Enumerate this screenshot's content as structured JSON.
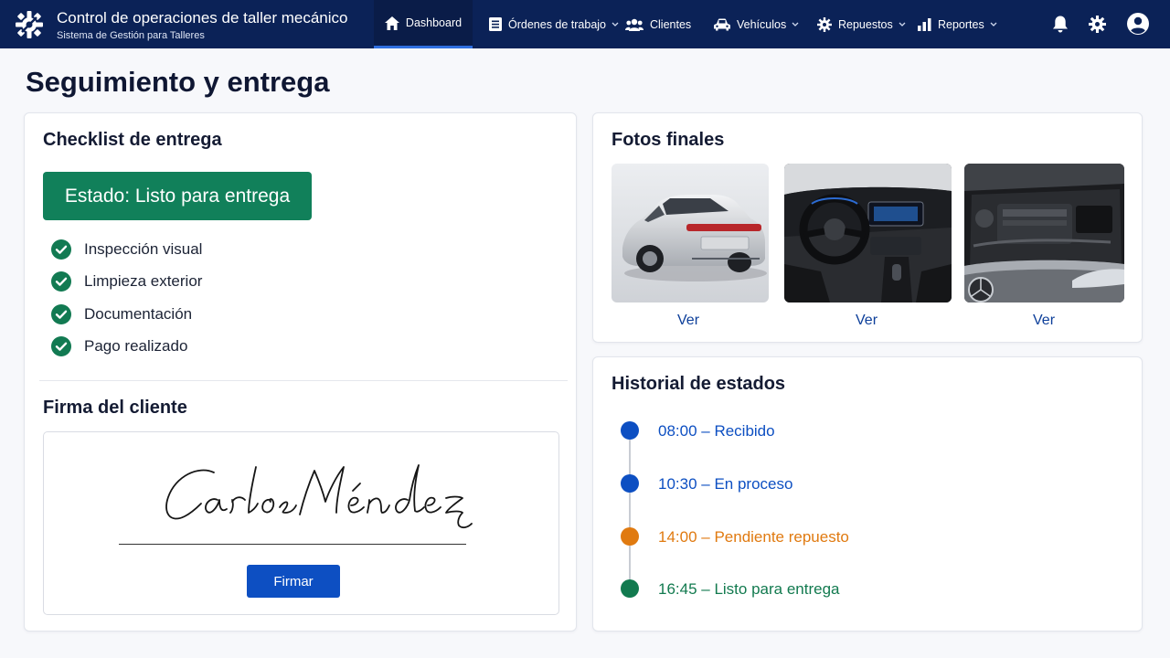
{
  "header": {
    "app_title": "Control de operaciones de taller mecánico",
    "app_subtitle": "Sistema de Gestión para Talleres",
    "logo_icon": "gear-wrench-logo-icon",
    "nav": [
      {
        "label": "Dashboard",
        "icon": "home-icon",
        "active": true,
        "dropdown": false
      },
      {
        "label": "Órdenes de trabajo",
        "icon": "list-icon",
        "active": false,
        "dropdown": true
      },
      {
        "label": "Clientes",
        "icon": "users-icon",
        "active": false,
        "dropdown": false
      },
      {
        "label": "Vehículos",
        "icon": "car-icon",
        "active": false,
        "dropdown": true
      },
      {
        "label": "Repuestos",
        "icon": "gear-icon",
        "active": false,
        "dropdown": true
      },
      {
        "label": "Reportes",
        "icon": "bar-chart-icon",
        "active": false,
        "dropdown": true
      }
    ],
    "actions": [
      "bell-icon",
      "settings-icon",
      "user-avatar-icon"
    ]
  },
  "page": {
    "title": "Seguimiento y entrega"
  },
  "checklist": {
    "title": "Checklist de entrega",
    "status_label": "Estado: Listo para entrega",
    "items": [
      {
        "label": "Inspección visual",
        "checked": true
      },
      {
        "label": "Limpieza exterior",
        "checked": true
      },
      {
        "label": "Documentación",
        "checked": true
      },
      {
        "label": "Pago realizado",
        "checked": true
      }
    ]
  },
  "signature": {
    "title": "Firma del cliente",
    "signature_name": "Carlos Méndez",
    "button_label": "Firmar"
  },
  "photos": {
    "title": "Fotos finales",
    "items": [
      {
        "subject": "rear-exterior",
        "link_label": "Ver"
      },
      {
        "subject": "interior-dashboard",
        "link_label": "Ver"
      },
      {
        "subject": "engine-bay",
        "link_label": "Ver"
      }
    ]
  },
  "history": {
    "title": "Historial de estados",
    "events": [
      {
        "label": "08:00 – Recibido",
        "color": "#0d4fc2"
      },
      {
        "label": "10:30 – En proceso",
        "color": "#0d4fc2"
      },
      {
        "label": "14:00 – Pendiente repuesto",
        "color": "#e07a10"
      },
      {
        "label": "16:45 – Listo para entrega",
        "color": "#127a4f"
      }
    ]
  },
  "colors": {
    "navbar": "#0b2257",
    "primary": "#0d4fc2",
    "success": "#11805a",
    "warning": "#e07a10",
    "link": "#0d3f9a"
  }
}
